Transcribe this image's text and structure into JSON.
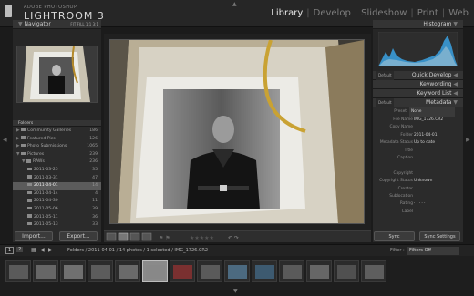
{
  "app": {
    "brand_small": "ADOBE PHOTOSHOP",
    "brand_big": "LIGHTROOM 3"
  },
  "modules": [
    "Library",
    "Develop",
    "Slideshow",
    "Print",
    "Web"
  ],
  "active_module": "Library",
  "navigator": {
    "title": "Navigator",
    "zoom": [
      "FIT",
      "FILL",
      "1:1",
      "3:1"
    ]
  },
  "folders_header": "Folders",
  "folders": [
    {
      "name": "Community Galleries",
      "count": "186",
      "indent": 1
    },
    {
      "name": "Featured Pics",
      "count": "126",
      "indent": 1
    },
    {
      "name": "Photo Submissions",
      "count": "1065",
      "indent": 1
    },
    {
      "name": "Pictures",
      "count": "239",
      "indent": 1
    },
    {
      "name": "RAWs",
      "count": "236",
      "indent": 2
    },
    {
      "name": "2011-03-25",
      "count": "35",
      "indent": 3
    },
    {
      "name": "2011-03-31",
      "count": "47",
      "indent": 3
    },
    {
      "name": "2011-04-01",
      "count": "14",
      "indent": 3,
      "selected": true
    },
    {
      "name": "2011-04-14",
      "count": "4",
      "indent": 3
    },
    {
      "name": "2011-04-30",
      "count": "11",
      "indent": 3
    },
    {
      "name": "2011-05-06",
      "count": "39",
      "indent": 3
    },
    {
      "name": "2011-05-11",
      "count": "36",
      "indent": 3
    },
    {
      "name": "2011-05-13",
      "count": "33",
      "indent": 3
    }
  ],
  "left_buttons": {
    "import": "Import...",
    "export": "Export..."
  },
  "right_panel": {
    "histogram": "Histogram",
    "quick_develop": "Quick Develop",
    "keywording": "Keywording",
    "keyword_list": "Keyword List",
    "metadata": "Metadata",
    "default_label": "Default",
    "preset_label": "Preset",
    "preset_value": "None"
  },
  "metadata_rows": [
    {
      "k": "File Name",
      "v": "IMG_1726.CR2"
    },
    {
      "k": "Copy Name",
      "v": ""
    },
    {
      "k": "Folder",
      "v": "2011-04-01"
    },
    {
      "k": "Metadata Status",
      "v": "Up to date"
    },
    {
      "k": "Title",
      "v": ""
    },
    {
      "k": "Caption",
      "v": ""
    },
    {
      "k": "",
      "v": ""
    },
    {
      "k": "Copyright",
      "v": ""
    },
    {
      "k": "Copyright Status",
      "v": "Unknown"
    },
    {
      "k": "Creator",
      "v": ""
    },
    {
      "k": "Sublocation",
      "v": ""
    },
    {
      "k": "Rating",
      "v": "· · · · ·"
    },
    {
      "k": "Label",
      "v": ""
    }
  ],
  "sync_buttons": {
    "sync": "Sync",
    "sync_settings": "Sync Settings"
  },
  "filmstrip_path": "Folders / 2011-04-01 / 14 photos / 1 selected / IMG_1726.CR2",
  "filter": {
    "label": "Filter :",
    "value": "Filters Off"
  },
  "page_indicator": [
    "1",
    "2"
  ],
  "filmstrip_count": 14,
  "filmstrip_selected": 5,
  "colors": {
    "accent_hist": "#3a9bd8",
    "bg": "#1b1b1b",
    "panel": "#2b2b2b"
  }
}
